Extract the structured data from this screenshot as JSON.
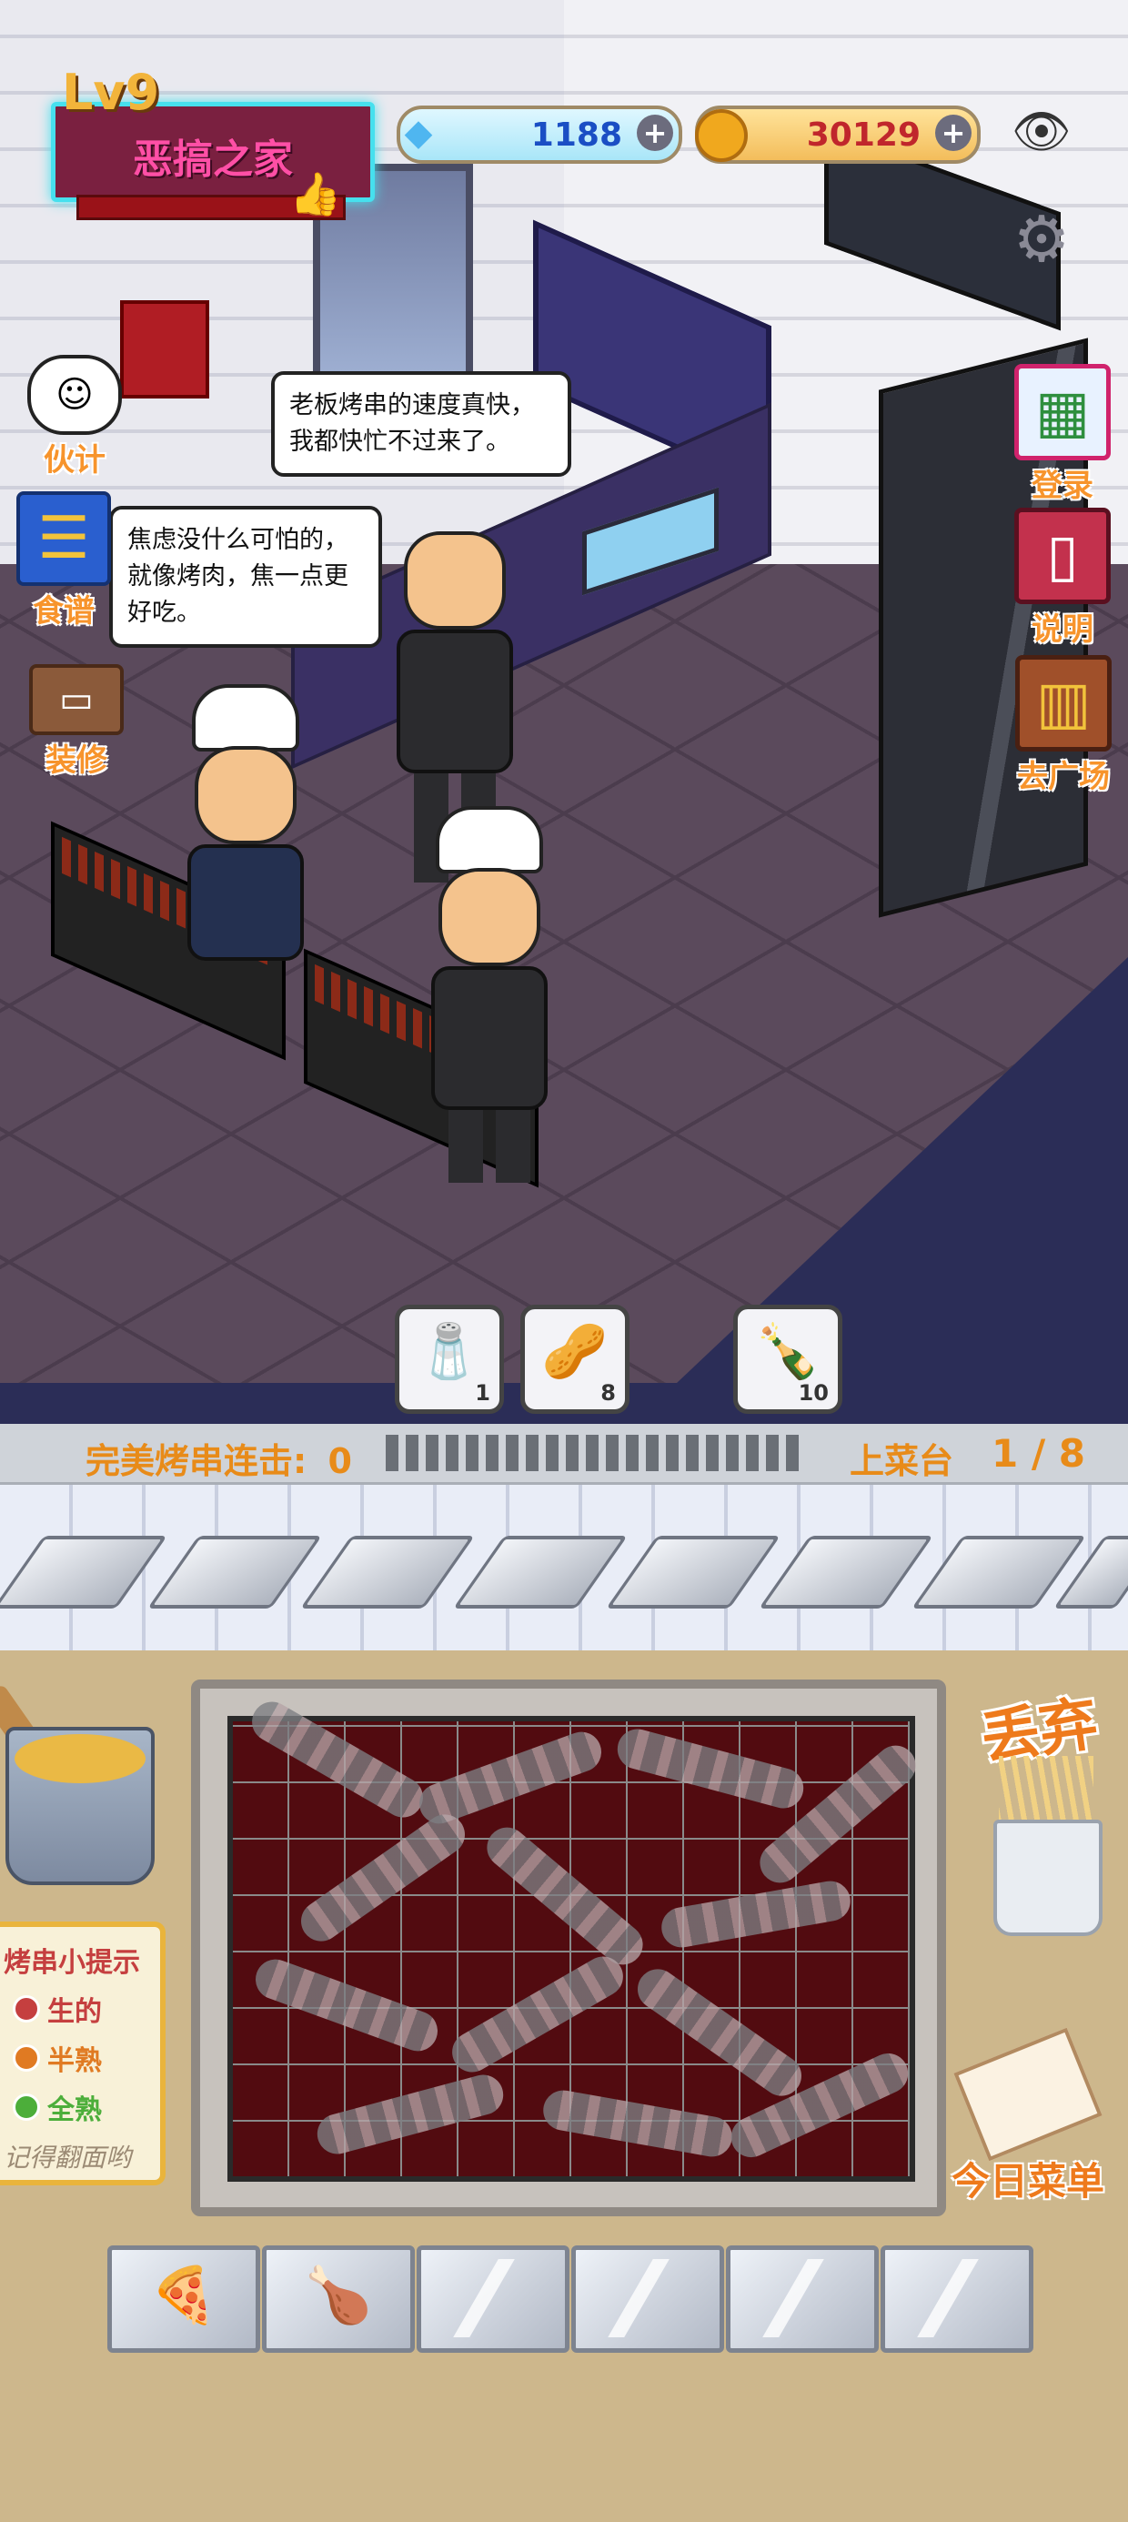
{
  "hud": {
    "level": "Lv9",
    "restaurant_name": "恶搞之家",
    "gems": "1188",
    "coins": "30129",
    "plus": "+"
  },
  "side_menu_left": {
    "staff_label": "伙计",
    "recipe_label": "食谱",
    "decor_label": "装修"
  },
  "side_menu_right": {
    "login_label": "登录",
    "help_label": "说明",
    "plaza_label": "去广场"
  },
  "dialogs": {
    "boss_speech": "老板烤串的速度真快，我都快忙不过来了。",
    "chef_speech": "焦虑没什么可怕的，就像烤肉，焦一点更好吃。"
  },
  "ingredients": [
    {
      "icon": "salt-bag",
      "count": "1"
    },
    {
      "icon": "peanuts",
      "count": "8"
    },
    {
      "icon": "sauce-bottle",
      "count": "10"
    }
  ],
  "status_bar": {
    "combo_label": "完美烤串连击:",
    "combo_value": "0",
    "serve_label": "上菜台",
    "serve_count": "1 / 8"
  },
  "tips": {
    "title": "烤串小提示",
    "raw": "生的",
    "half": "半熟",
    "done": "全熟",
    "note": "记得翻面哟"
  },
  "actions": {
    "discard_label": "丢弃",
    "menu_label": "今日菜单"
  },
  "colors": {
    "raw": "#c53f3f",
    "half": "#e07a22",
    "done": "#4cae3a",
    "accent": "#ee7a1c"
  }
}
